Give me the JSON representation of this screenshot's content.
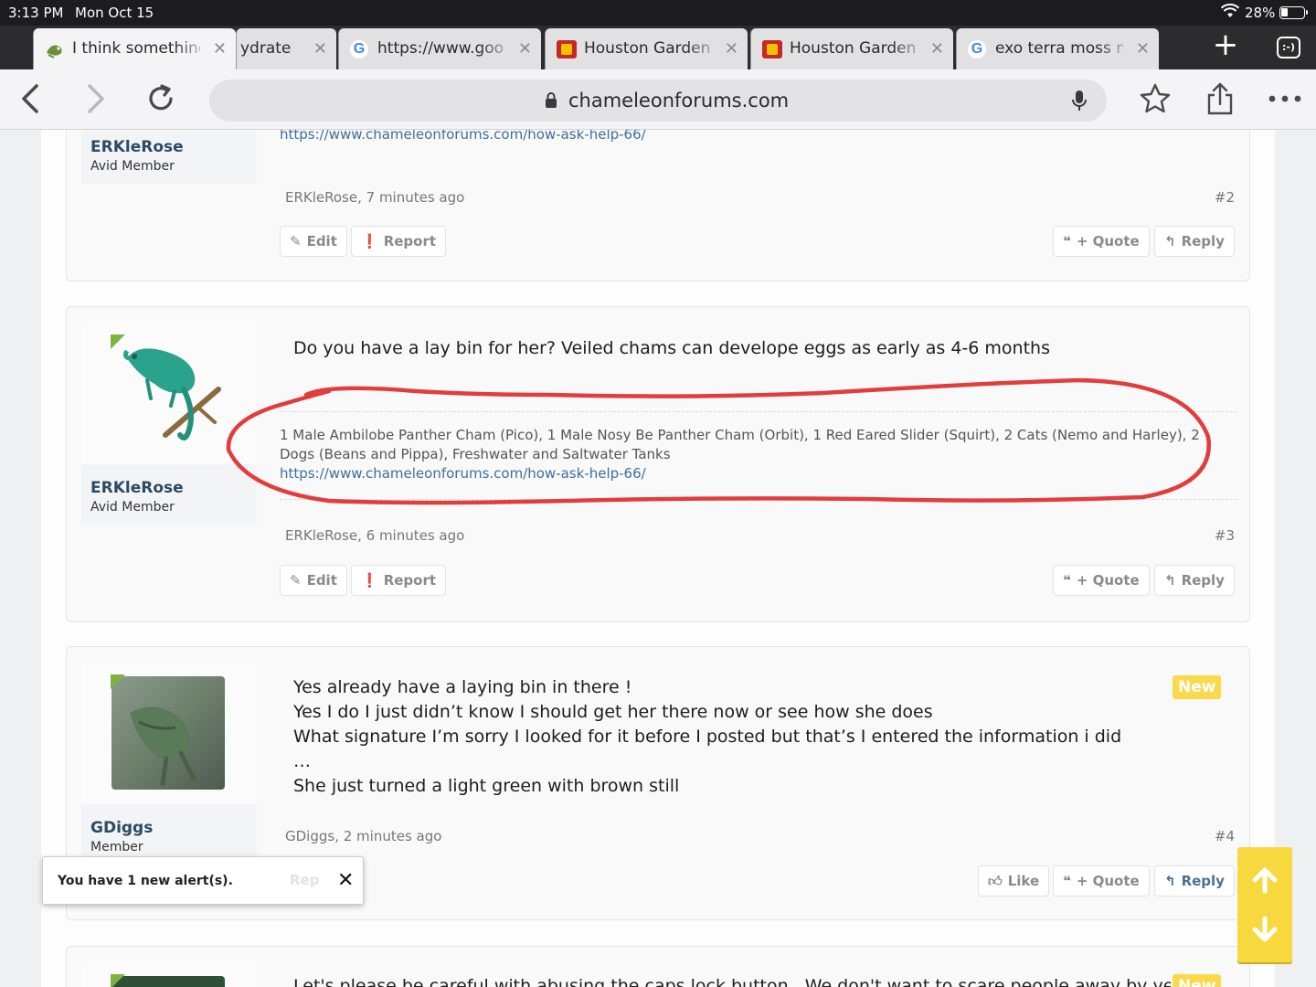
{
  "status_bar": {
    "time": "3:13 PM",
    "date": "Mon Oct 15",
    "battery": "28%"
  },
  "tabs": [
    {
      "title": "I think something",
      "favicon": "chameleon-favicon",
      "active": true
    },
    {
      "title": "ydrate",
      "favicon": "none",
      "active": false
    },
    {
      "title": "https://www.goo",
      "favicon": "google-g",
      "active": false
    },
    {
      "title": "Houston Garden",
      "favicon": "houston-garden-favicon",
      "active": false
    },
    {
      "title": "Houston Garden",
      "favicon": "houston-garden-favicon",
      "active": false
    },
    {
      "title": "exo terra moss m",
      "favicon": "google-g",
      "active": false
    }
  ],
  "tab_switcher_label": ":-)",
  "address_bar": {
    "url": "chameleonforums.com"
  },
  "posts": [
    {
      "sig_link": "https://www.chameleonforums.com/how-ask-help-66/",
      "username": "ERKleRose",
      "user_title": "Avid Member",
      "meta": "ERKleRose, 7 minutes ago",
      "post_number": "#2",
      "buttons": {
        "edit": "Edit",
        "report": "Report",
        "quote": "+ Quote",
        "reply": "Reply"
      }
    },
    {
      "text": "Do you have a lay bin for her? Veiled chams can develope eggs as early as 4-6 months",
      "signature": "1 Male Ambilobe Panther Cham (Pico), 1 Male Nosy Be Panther Cham (Orbit), 1 Red Eared Slider (Squirt), 2 Cats (Nemo and Harley), 2 Dogs (Beans and Pippa), Freshwater and Saltwater Tanks",
      "sig_link": "https://www.chameleonforums.com/how-ask-help-66/",
      "username": "ERKleRose",
      "user_title": "Avid Member",
      "meta": "ERKleRose, 6 minutes ago",
      "post_number": "#3",
      "buttons": {
        "edit": "Edit",
        "report": "Report",
        "quote": "+ Quote",
        "reply": "Reply"
      }
    },
    {
      "lines": [
        "Yes already have a laying bin in there !",
        "Yes I do I just didn’t know I should get her there now or see how she does",
        "What signature I’m sorry I looked for it before I posted but that’s I entered the information i did",
        "…",
        "She just turned a light green with brown still"
      ],
      "badge": "New",
      "username": "GDiggs",
      "user_title": "Member",
      "meta": "GDiggs, 2 minutes ago",
      "post_number": "#4",
      "buttons": {
        "report": "Rep",
        "like": "Like",
        "quote": "+ Quote",
        "reply": "Reply"
      }
    },
    {
      "text": "Let's please be careful with abusing the caps lock button.. We don't want to scare people away by yelling",
      "badge": "New"
    }
  ],
  "alert": {
    "message": "You have 1 new alert(s)."
  },
  "colors": {
    "annotation": "#e23c3c",
    "badge": "#fbd94a",
    "username": "#2b4a63",
    "link": "#3d6f9c"
  }
}
